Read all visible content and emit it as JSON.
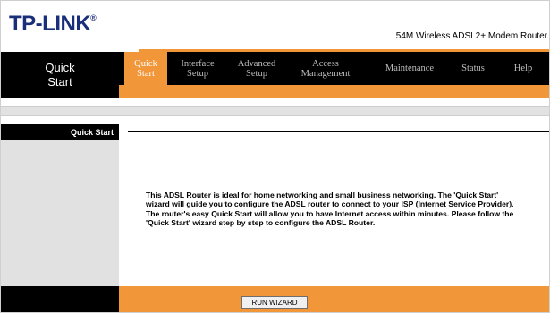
{
  "header": {
    "logo_text": "TP-LINK",
    "logo_mark": "®",
    "model": "54M Wireless ADSL2+ Modem Router"
  },
  "nav": {
    "current_section": "Quick Start",
    "tabs": [
      {
        "label": "Quick Start",
        "active": true
      },
      {
        "label": "Interface Setup",
        "active": false
      },
      {
        "label": "Advanced Setup",
        "active": false
      },
      {
        "label": "Access Management",
        "active": false
      },
      {
        "label": "Maintenance",
        "active": false
      },
      {
        "label": "Status",
        "active": false
      },
      {
        "label": "Help",
        "active": false
      }
    ]
  },
  "section": {
    "title": "Quick Start"
  },
  "content": {
    "description": "This ADSL Router is ideal for home networking and small business networking. The 'Quick Start' wizard will guide you to configure the ADSL router to connect to your ISP (Internet Service Provider). The router's easy Quick Start will allow you to have Internet access within minutes. Please follow the 'Quick Start' wizard step by step to configure the ADSL Router."
  },
  "footer": {
    "run_wizard_label": "RUN WIZARD"
  },
  "colors": {
    "accent": "#f2963a",
    "nav_bg": "#000000",
    "logo": "#1a2f7a"
  }
}
